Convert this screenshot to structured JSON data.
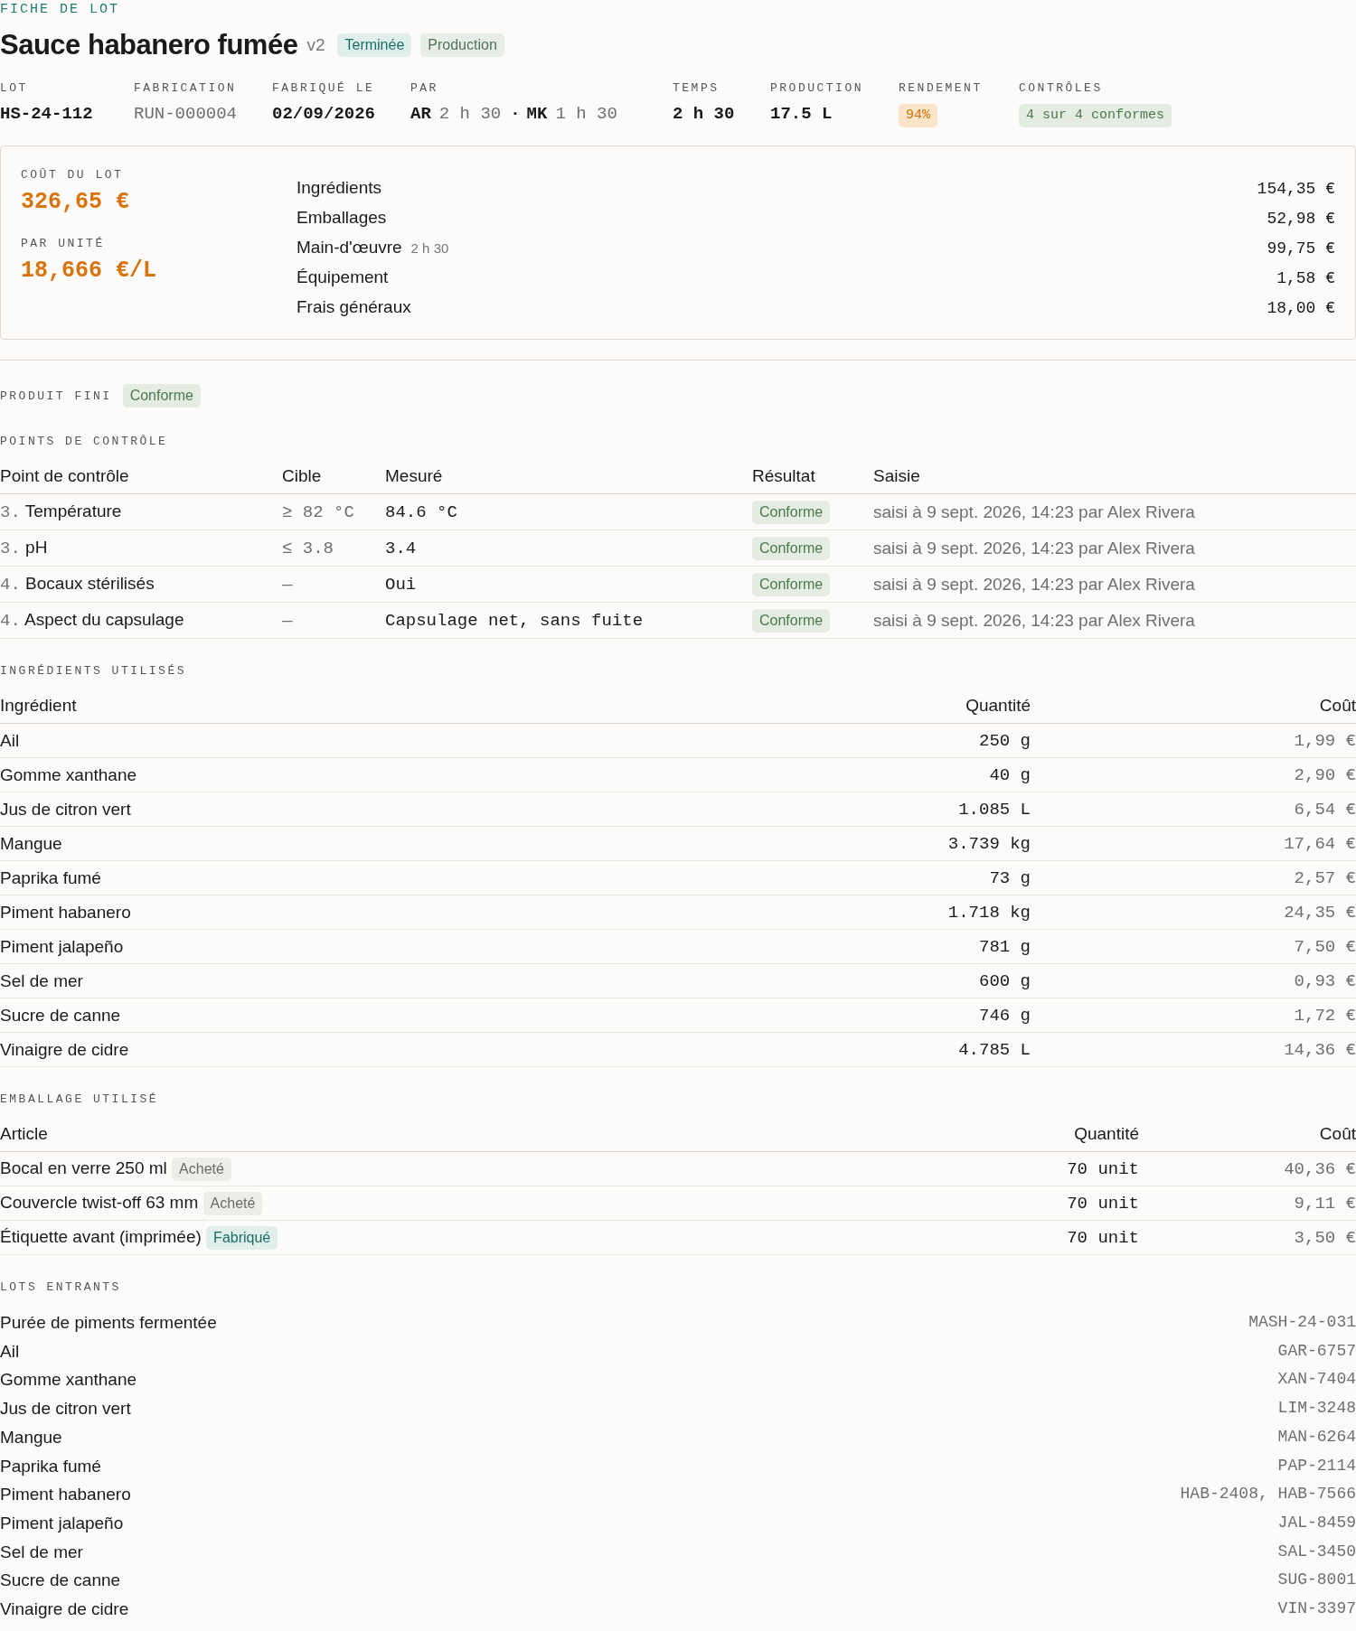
{
  "eyebrow": "FICHE DE LOT",
  "header": {
    "title": "Sauce habanero fumée",
    "version": "v2",
    "tags": [
      {
        "label": "Terminée",
        "kind": "status"
      },
      {
        "label": "Production",
        "kind": "type"
      }
    ]
  },
  "meta": [
    {
      "label": "LOT",
      "kind": "plain",
      "value": "HS-24-112"
    },
    {
      "label": "FABRICATION",
      "kind": "muted",
      "value": "RUN-000004"
    },
    {
      "label": "FABRIQUÉ LE",
      "kind": "plain",
      "value": "02/09/2026"
    },
    {
      "label": "PAR",
      "kind": "operators",
      "operators": [
        {
          "initials": "AR",
          "time": "2 h 30"
        },
        {
          "initials": "MK",
          "time": "1 h 30"
        }
      ],
      "separator": "·"
    },
    {
      "label": "TEMPS",
      "kind": "plain",
      "value": "2 h 30"
    },
    {
      "label": "PRODUCTION",
      "kind": "plain",
      "value": "17.5 L"
    },
    {
      "label": "RENDEMENT",
      "kind": "warn",
      "value": "94%"
    },
    {
      "label": "CONTRÔLES",
      "kind": "ok",
      "value": "4 sur 4 conformes"
    }
  ],
  "cost": {
    "total_label": "COÛT DU LOT",
    "total": "326,65 €",
    "unit_label": "PAR UNITÉ",
    "unit": "18,666 €/L",
    "lines": [
      {
        "label": "Ingrédients",
        "amount": "154,35 €"
      },
      {
        "label": "Emballages",
        "amount": "52,98 €"
      },
      {
        "label": "Main-d'œuvre",
        "note": "2 h 30",
        "amount": "99,75 €"
      },
      {
        "label": "Équipement",
        "amount": "1,58 €"
      },
      {
        "label": "Frais généraux",
        "amount": "18,00 €"
      }
    ]
  },
  "finished": {
    "label": "PRODUIT FINI",
    "tag": {
      "label": "Conforme",
      "kind": "ok"
    }
  },
  "checkpoints": {
    "title": "POINTS DE CONTRÔLE",
    "columns": [
      "Point de contrôle",
      "Cible",
      "Mesuré",
      "Résultat",
      "Saisie"
    ],
    "rows": [
      {
        "step": "3.",
        "name": "Température",
        "target": "≥ 82 °C",
        "measured": "84.6 °C",
        "result": {
          "label": "Conforme",
          "kind": "ok"
        },
        "entry": "saisi à 9 sept. 2026, 14:23 par Alex Rivera"
      },
      {
        "step": "3.",
        "name": "pH",
        "target": "≤ 3.8",
        "measured": "3.4",
        "result": {
          "label": "Conforme",
          "kind": "ok"
        },
        "entry": "saisi à 9 sept. 2026, 14:23 par Alex Rivera"
      },
      {
        "step": "4.",
        "name": "Bocaux stérilisés",
        "target": "—",
        "measured": "Oui",
        "result": {
          "label": "Conforme",
          "kind": "ok"
        },
        "entry": "saisi à 9 sept. 2026, 14:23 par Alex Rivera"
      },
      {
        "step": "4.",
        "name": "Aspect du capsulage",
        "target": "—",
        "measured": "Capsulage net, sans fuite",
        "result": {
          "label": "Conforme",
          "kind": "ok"
        },
        "entry": "saisi à 9 sept. 2026, 14:23 par Alex Rivera"
      }
    ]
  },
  "ingredients": {
    "title": "INGRÉDIENTS UTILISÉS",
    "columns": [
      "Ingrédient",
      "Quantité",
      "Coût"
    ],
    "rows": [
      {
        "name": "Ail",
        "qty": "250 g",
        "cost": "1,99 €"
      },
      {
        "name": "Gomme xanthane",
        "qty": "40 g",
        "cost": "2,90 €"
      },
      {
        "name": "Jus de citron vert",
        "qty": "1.085 L",
        "cost": "6,54 €"
      },
      {
        "name": "Mangue",
        "qty": "3.739 kg",
        "cost": "17,64 €"
      },
      {
        "name": "Paprika fumé",
        "qty": "73 g",
        "cost": "2,57 €"
      },
      {
        "name": "Piment habanero",
        "qty": "1.718 kg",
        "cost": "24,35 €"
      },
      {
        "name": "Piment jalapeño",
        "qty": "781 g",
        "cost": "7,50 €"
      },
      {
        "name": "Sel de mer",
        "qty": "600 g",
        "cost": "0,93 €"
      },
      {
        "name": "Sucre de canne",
        "qty": "746 g",
        "cost": "1,72 €"
      },
      {
        "name": "Vinaigre de cidre",
        "qty": "4.785 L",
        "cost": "14,36 €"
      }
    ]
  },
  "packaging": {
    "title": "EMBALLAGE UTILISÉ",
    "columns": [
      "Article",
      "Quantité",
      "Coût"
    ],
    "rows": [
      {
        "name": "Bocal en verre 250 ml",
        "tag": {
          "label": "Acheté",
          "kind": "neutral"
        },
        "qty": "70 unit",
        "cost": "40,36 €"
      },
      {
        "name": "Couvercle twist-off 63 mm",
        "tag": {
          "label": "Acheté",
          "kind": "neutral"
        },
        "qty": "70 unit",
        "cost": "9,11 €"
      },
      {
        "name": "Étiquette avant (imprimée)",
        "tag": {
          "label": "Fabriqué",
          "kind": "status"
        },
        "qty": "70 unit",
        "cost": "3,50 €"
      }
    ]
  },
  "input_lots": {
    "title": "LOTS ENTRANTS",
    "rows": [
      {
        "name": "Purée de piments fermentée",
        "lots": "MASH-24-031"
      },
      {
        "name": "Ail",
        "lots": "GAR-6757"
      },
      {
        "name": "Gomme xanthane",
        "lots": "XAN-7404"
      },
      {
        "name": "Jus de citron vert",
        "lots": "LIM-3248"
      },
      {
        "name": "Mangue",
        "lots": "MAN-6264"
      },
      {
        "name": "Paprika fumé",
        "lots": "PAP-2114"
      },
      {
        "name": "Piment habanero",
        "lots": "HAB-2408, HAB-7566"
      },
      {
        "name": "Piment jalapeño",
        "lots": "JAL-8459"
      },
      {
        "name": "Sel de mer",
        "lots": "SAL-3450"
      },
      {
        "name": "Sucre de canne",
        "lots": "SUG-8001"
      },
      {
        "name": "Vinaigre de cidre",
        "lots": "VIN-3397"
      }
    ]
  }
}
